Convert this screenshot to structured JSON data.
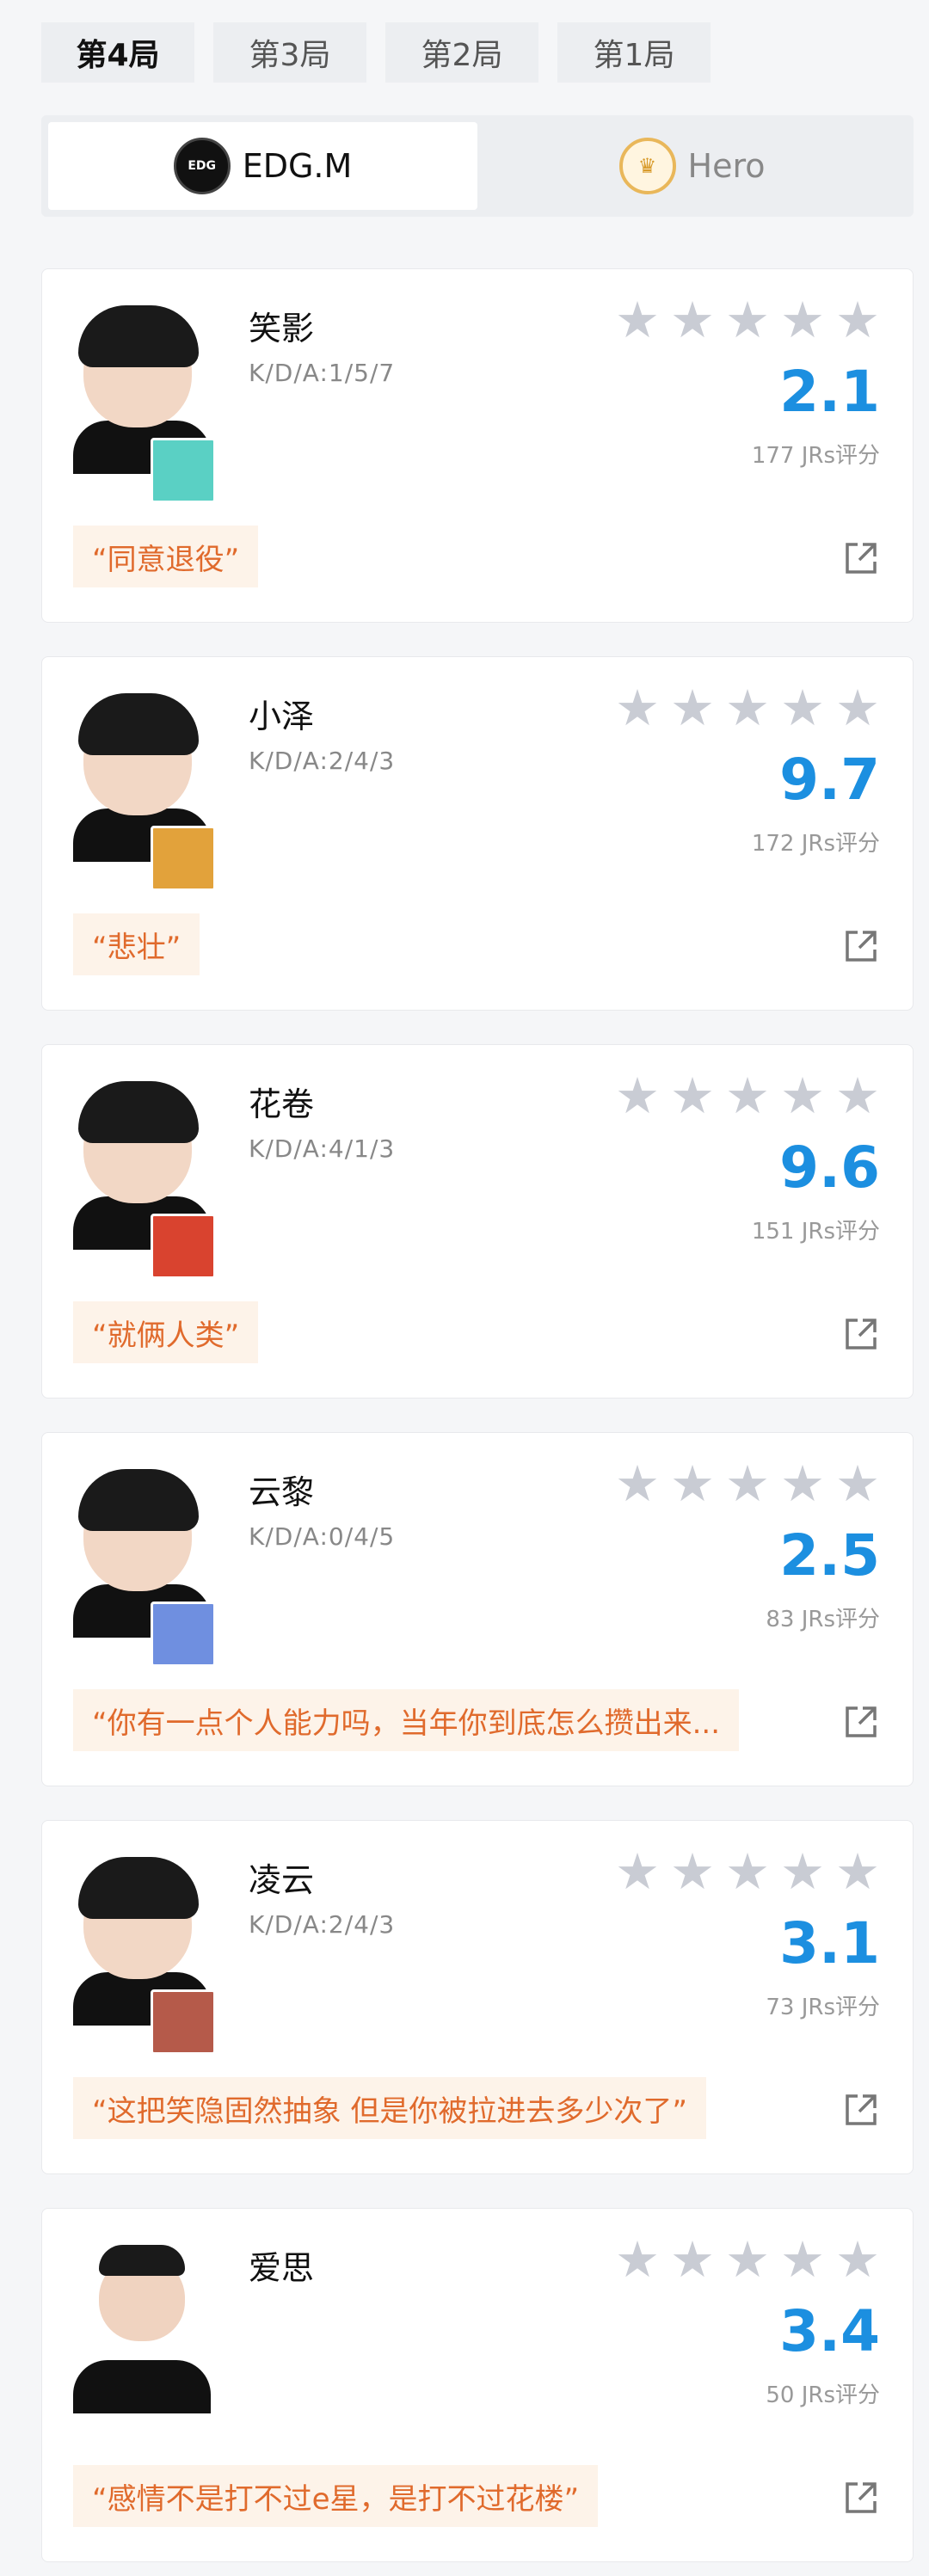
{
  "game_tabs": [
    "第4局",
    "第3局",
    "第2局",
    "第1局"
  ],
  "teams": [
    {
      "name": "EDG.M",
      "logo_text": "EDG"
    },
    {
      "name": "Hero",
      "logo_text": "♛"
    }
  ],
  "icons": {
    "star": "star-icon",
    "share": "share-icon"
  },
  "colors": {
    "rating": "#1c8fe0",
    "comment_text": "#e06a2c",
    "comment_bg": "#fdf3e9",
    "star_empty": "#c9ccd4"
  },
  "players": [
    {
      "name": "笑影",
      "kda": "K/D/A:1/5/7",
      "rating": "2.1",
      "count": "177 JRs评分",
      "comment": "“同意退役”",
      "hero_color": "#5ad0c4"
    },
    {
      "name": "小泽",
      "kda": "K/D/A:2/4/3",
      "rating": "9.7",
      "count": "172 JRs评分",
      "comment": "“悲壮”",
      "hero_color": "#e2a23b"
    },
    {
      "name": "花卷",
      "kda": "K/D/A:4/1/3",
      "rating": "9.6",
      "count": "151 JRs评分",
      "comment": "“就俩人类”",
      "hero_color": "#d9432f"
    },
    {
      "name": "云黎",
      "kda": "K/D/A:0/4/5",
      "rating": "2.5",
      "count": "83 JRs评分",
      "comment": "“你有一点个人能力吗，当年你到底怎么攒出来...",
      "hero_color": "#6f8fe0"
    },
    {
      "name": "凌云",
      "kda": "K/D/A:2/4/3",
      "rating": "3.1",
      "count": "73 JRs评分",
      "comment": "“这把笑隐固然抽象 但是你被拉进去多少次了”",
      "hero_color": "#b55a4a"
    },
    {
      "name": "爱思",
      "kda": "",
      "rating": "3.4",
      "count": "50 JRs评分",
      "comment": "“感情不是打不过e星，是打不过花楼”",
      "hero_color": ""
    }
  ]
}
